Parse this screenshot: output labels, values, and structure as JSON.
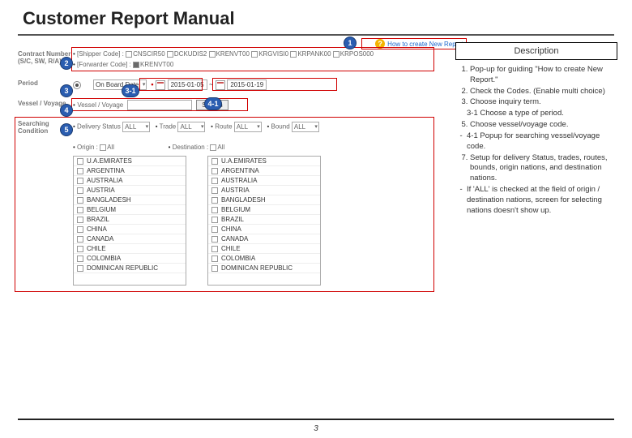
{
  "pageTitle": "Customer Report Manual",
  "pageNumber": "3",
  "howto": {
    "label": "How to create New Report"
  },
  "description": {
    "header": "Description",
    "items": [
      "Pop-up for guiding \"How to create New Report.\"",
      "Check the Codes. (Enable multi choice)",
      "Choose inquiry term.",
      "3-1 Choose a type of period.",
      "Choose vessel/voyage code.",
      "4-1 Popup for searching vessel/voyage code.",
      "Setup for delivery Status, trades, routes, bounds, origin nations, and destination nations.",
      "If 'ALL' is checked at the field of origin / destination nations, screen for selecting nations doesn't show up."
    ]
  },
  "badges": {
    "b1": "1",
    "b2": "2",
    "b3": "3",
    "b31": "3-1",
    "b4": "4",
    "b41": "4-1",
    "b5": "5"
  },
  "labels": {
    "contract": "Contract Number (S/C, SW, R/A)",
    "period": "Period",
    "vessel": "Vessel / Voyage",
    "searchcond": "Searching Condition",
    "shipper": "[Shipper Code] :",
    "forwarder": "[Forwarder Code] :",
    "onboard": "On Board Date",
    "tilde": "~",
    "vesselField": "Vessel / Voyage",
    "search": "Search",
    "delivery": "Delivery Status",
    "trade": "Trade",
    "route": "Route",
    "bound": "Bound",
    "origin": "Origin :",
    "dest": "Destination :",
    "all": "All"
  },
  "codes": {
    "shipper": [
      "CNSCIR50",
      "DCKUDIS2",
      "KRENVT00",
      "KRGVISI0",
      "KRPANK00",
      "KRPOS000"
    ],
    "forwarder": [
      "KRENVT00"
    ]
  },
  "dates": {
    "from": "2015-01-05",
    "to": "2015-01-19"
  },
  "selects": {
    "delivery": "ALL",
    "trade": "ALL",
    "route": "ALL",
    "bound": "ALL"
  },
  "nations": [
    "U.A.EMIRATES",
    "ARGENTINA",
    "AUSTRALIA",
    "AUSTRIA",
    "BANGLADESH",
    "BELGIUM",
    "BRAZIL",
    "CHINA",
    "CANADA",
    "CHILE",
    "COLOMBIA",
    "DOMINICAN REPUBLIC"
  ]
}
